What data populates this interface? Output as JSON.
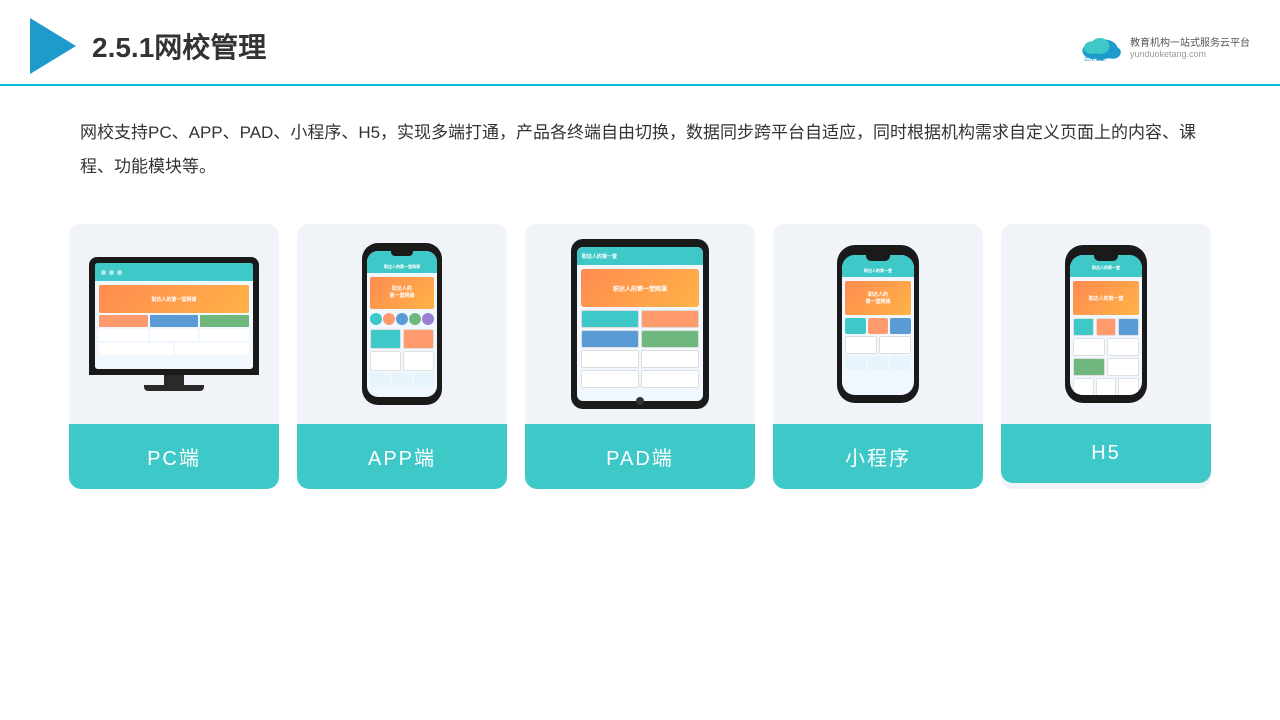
{
  "header": {
    "title": "2.5.1网校管理",
    "brand": {
      "name": "云朵课堂",
      "url": "yunduoketang.com",
      "tagline": "教育机构一站式服务云平台"
    }
  },
  "description": "网校支持PC、APP、PAD、小程序、H5，实现多端打通，产品各终端自由切换，数据同步跨平台自适应，同时根据机构需求自定义页面上的内容、课程、功能模块等。",
  "cards": [
    {
      "label": "PC端",
      "type": "pc"
    },
    {
      "label": "APP端",
      "type": "app"
    },
    {
      "label": "PAD端",
      "type": "pad"
    },
    {
      "label": "小程序",
      "type": "mini"
    },
    {
      "label": "H5",
      "type": "h5"
    }
  ],
  "colors": {
    "accent": "#3fc8c8",
    "header_border": "#00bcd4",
    "card_bg": "#f0f4f8"
  }
}
